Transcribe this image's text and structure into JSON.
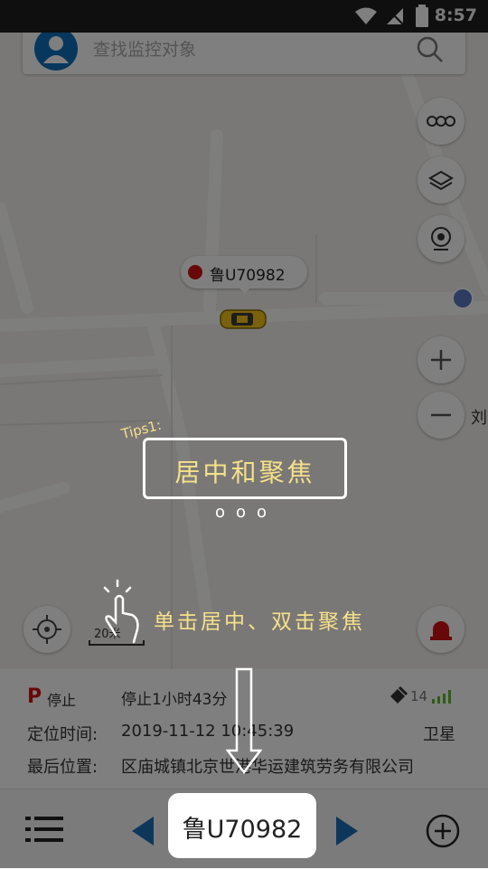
{
  "status_bar": {
    "time": "8:57"
  },
  "search": {
    "placeholder": "查找监控对象"
  },
  "map": {
    "vehicle_label": "鲁U70982",
    "place_label": "刘",
    "scale_label": "20米",
    "right_controls": [
      "route-icon",
      "layers-icon",
      "camera-icon",
      "zoom-in-icon",
      "zoom-out-icon"
    ]
  },
  "tutorial": {
    "tips_label": "Tips1:",
    "tips_title": "居中和聚焦",
    "dots": "ooo",
    "gesture_hint": "单击居中、双击聚焦"
  },
  "info": {
    "status_icon_letter": "P",
    "status_text": "停止",
    "duration_text": "停止1小时43分",
    "satellites": "14",
    "time_label": "定位时间:",
    "time_value": "2019-11-12 10:45:39",
    "location_type": "卫星",
    "address_label": "最后位置:",
    "address_value": "区庙城镇北京世港华运建筑劳务有限公司"
  },
  "bottom_bar": {
    "plate": "鲁U70982"
  },
  "colors": {
    "accent": "#0e6fb8",
    "nav_arrow": "#1a6fb5",
    "alert": "#d01010",
    "signal": "#5cb82c",
    "handwriting": "#f6e08a"
  }
}
